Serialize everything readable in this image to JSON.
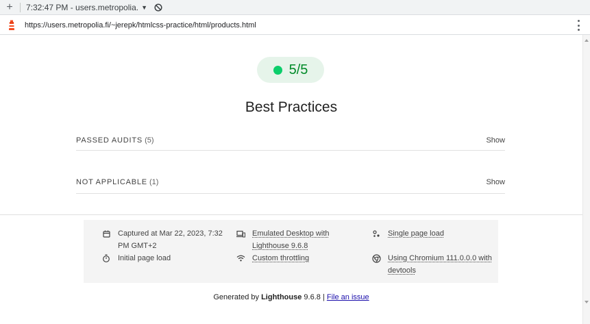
{
  "toolbar": {
    "new_tab_symbol": "+",
    "tab_title": "7:32:47 PM - users.metropolia.",
    "caret": "▼"
  },
  "address": {
    "url": "https://users.metropolia.fi/~jerepk/htmlcss-practice/html/products.html"
  },
  "score": {
    "value": "5/5",
    "color": "#0cce6b",
    "text_color": "#008a28",
    "bg": "#e6f4ea"
  },
  "category": {
    "title": "Best Practices"
  },
  "groups": [
    {
      "title": "PASSED AUDITS",
      "count": "(5)",
      "action": "Show"
    },
    {
      "title": "NOT APPLICABLE",
      "count": "(1)",
      "action": "Show"
    }
  ],
  "environment": {
    "captured": "Captured at Mar 22, 2023, 7:32 PM GMT+2",
    "initial_load": "Initial page load",
    "emulated": "Emulated Desktop with Lighthouse 9.6.8",
    "throttling": "Custom throttling",
    "single_load": "Single page load",
    "chromium": "Using Chromium 111.0.0.0 with devtools"
  },
  "footer": {
    "generated_by": "Generated by",
    "tool": "Lighthouse",
    "version": "9.6.8",
    "separator": "|",
    "issue_link": "File an issue"
  }
}
